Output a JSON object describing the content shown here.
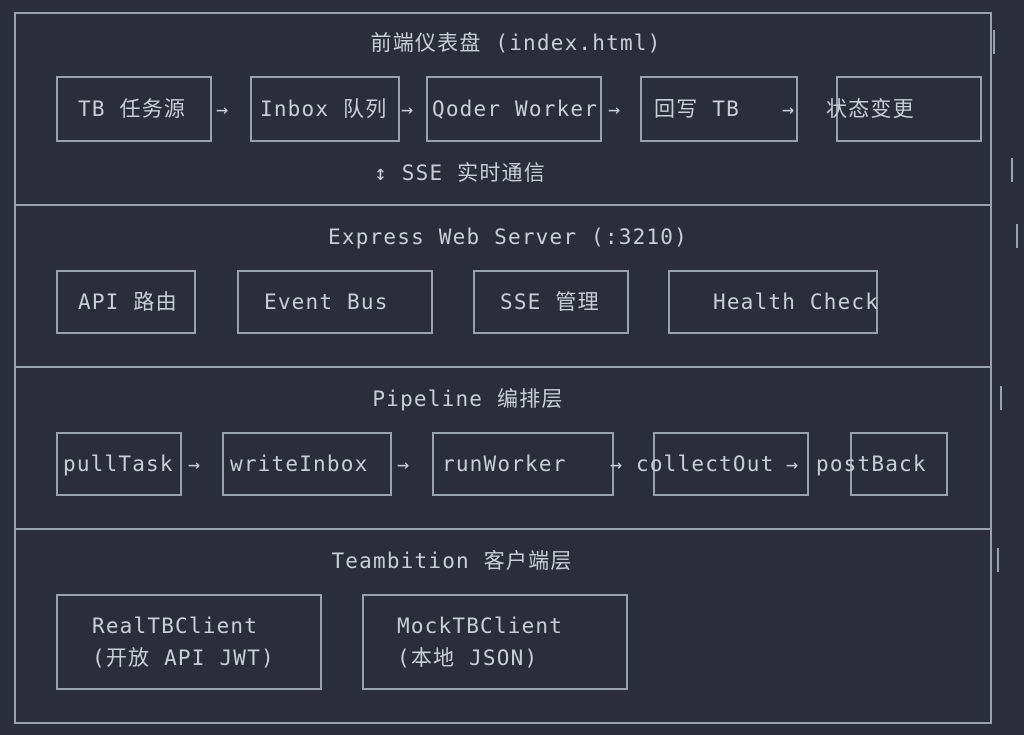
{
  "sections": {
    "frontend": {
      "title": "前端仪表盘 (index.html)",
      "flow": [
        "TB 任务源",
        "Inbox 队列",
        "Qoder Worker",
        "回写 TB",
        "状态变更"
      ],
      "note": "↕ SSE 实时通信"
    },
    "server": {
      "title": "Express Web Server (:3210)",
      "boxes": [
        "API 路由",
        "Event Bus",
        "SSE 管理",
        "Health Check"
      ]
    },
    "pipeline": {
      "title": "Pipeline 编排层",
      "flow": [
        "pullTask",
        "writeInbox",
        "runWorker",
        "collectOut",
        "postBack"
      ]
    },
    "client": {
      "title": "Teambition 客户端层",
      "boxes": [
        {
          "name": "RealTBClient",
          "desc": "(开放 API JWT)"
        },
        {
          "name": "MockTBClient",
          "desc": "(本地 JSON)"
        }
      ]
    }
  },
  "arrow_symbol": "→"
}
